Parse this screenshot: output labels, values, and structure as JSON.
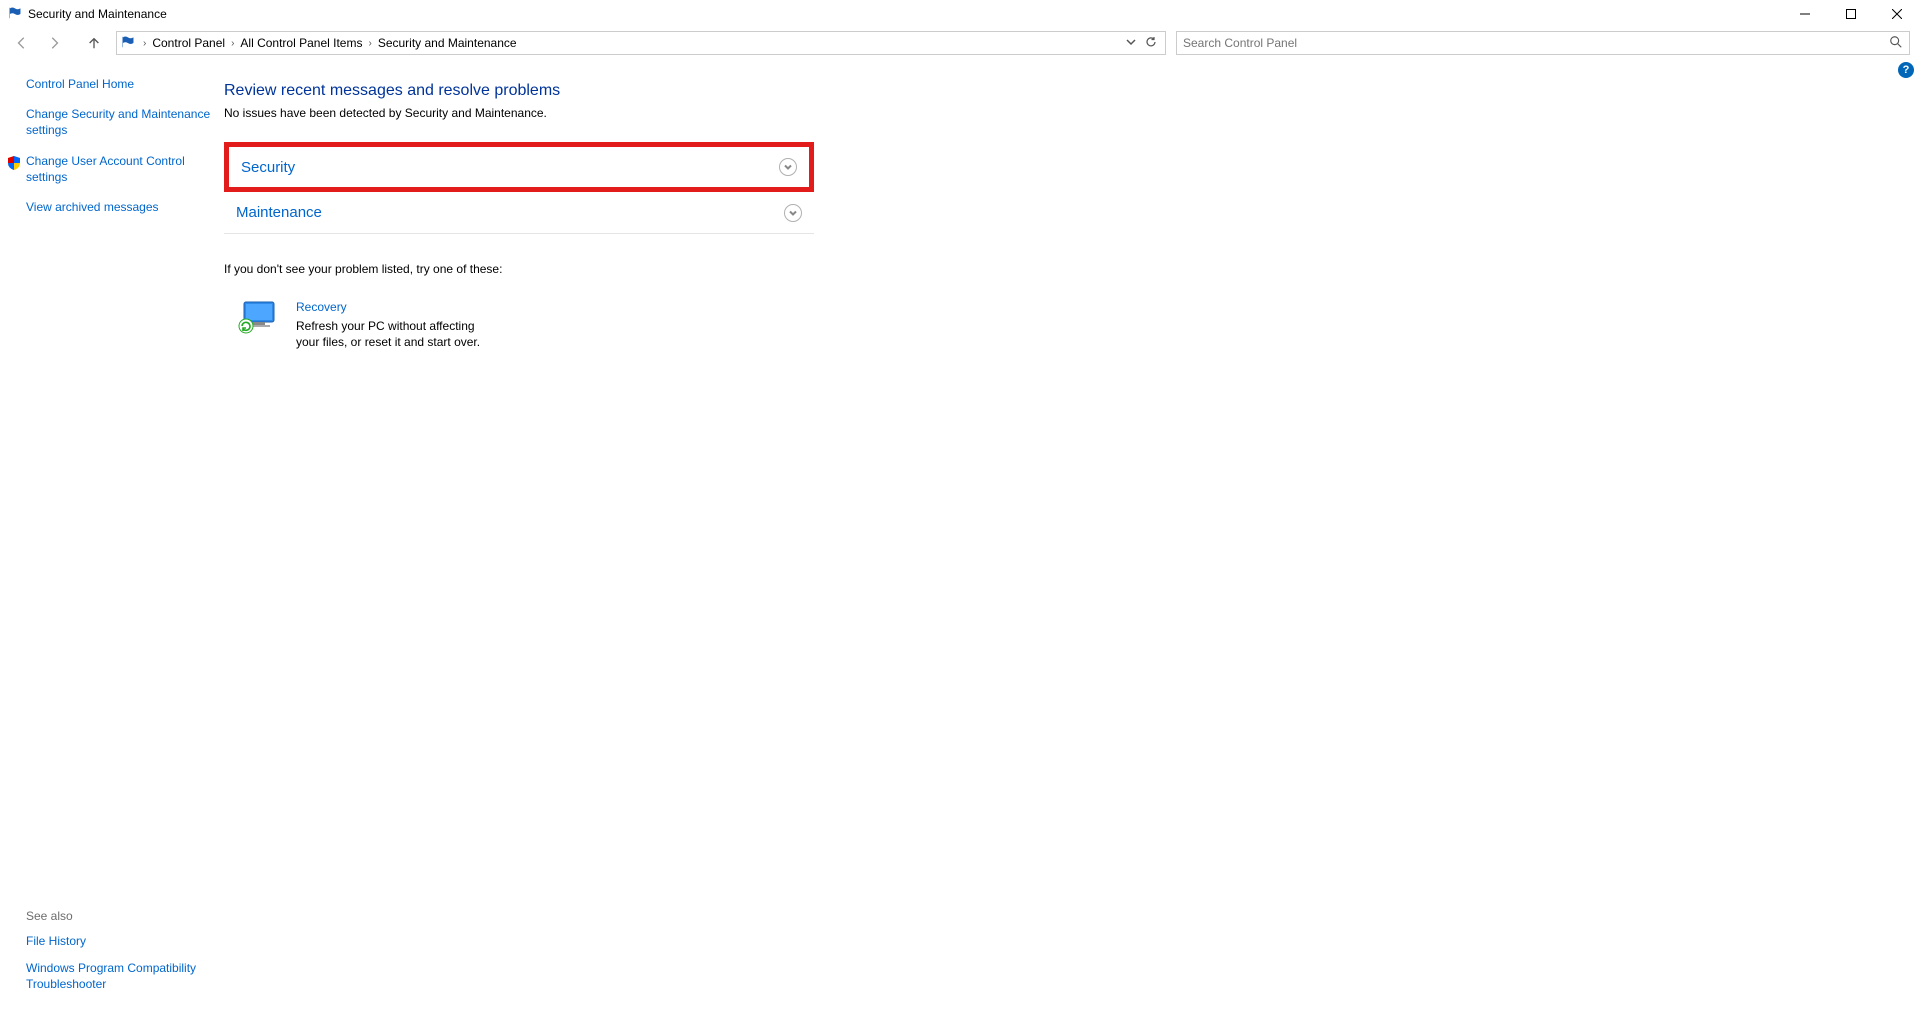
{
  "window": {
    "title": "Security and Maintenance"
  },
  "breadcrumb": {
    "items": [
      "Control Panel",
      "All Control Panel Items",
      "Security and Maintenance"
    ]
  },
  "search": {
    "placeholder": "Search Control Panel"
  },
  "sidebar": {
    "links": {
      "home": "Control Panel Home",
      "change_settings": "Change Security and Maintenance settings",
      "uac": "Change User Account Control settings",
      "archived": "View archived messages"
    },
    "see_also": {
      "title": "See also",
      "file_history": "File History",
      "compat": "Windows Program Compatibility Troubleshooter"
    }
  },
  "main": {
    "heading": "Review recent messages and resolve problems",
    "subtext": "No issues have been detected by Security and Maintenance.",
    "sections": {
      "security": "Security",
      "maintenance": "Maintenance"
    },
    "footer_prompt": "If you don't see your problem listed, try one of these:",
    "recovery": {
      "title": "Recovery",
      "desc": "Refresh your PC without affecting your files, or reset it and start over."
    }
  }
}
